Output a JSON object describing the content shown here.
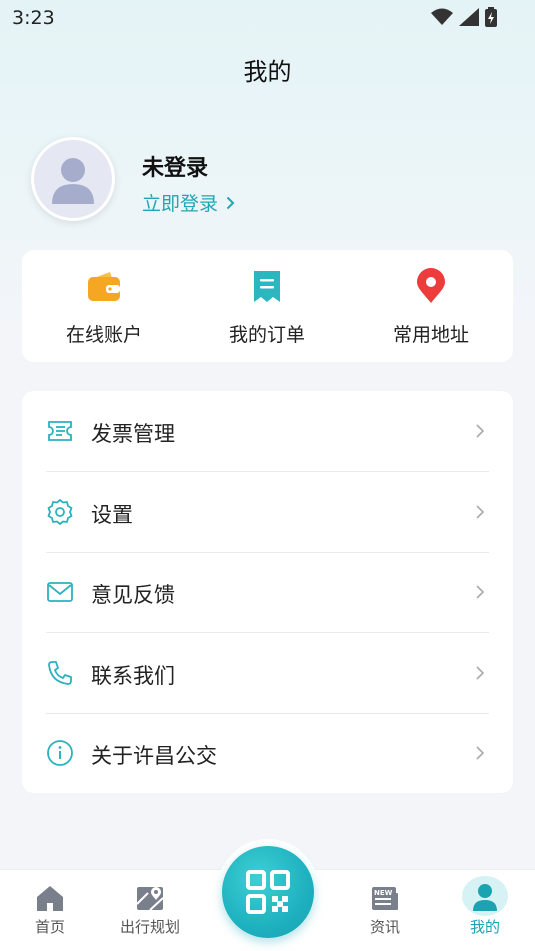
{
  "status_bar": {
    "time": "3:23"
  },
  "header": {
    "title": "我的"
  },
  "profile": {
    "name": "未登录",
    "login_link": "立即登录"
  },
  "quick_actions": [
    {
      "label": "在线账户",
      "icon": "wallet-icon"
    },
    {
      "label": "我的订单",
      "icon": "receipt-icon"
    },
    {
      "label": "常用地址",
      "icon": "location-pin-icon"
    }
  ],
  "menu": [
    {
      "label": "发票管理",
      "icon": "ticket-icon"
    },
    {
      "label": "设置",
      "icon": "gear-icon"
    },
    {
      "label": "意见反馈",
      "icon": "mail-icon"
    },
    {
      "label": "联系我们",
      "icon": "phone-icon"
    },
    {
      "label": "关于许昌公交",
      "icon": "info-icon"
    }
  ],
  "tabbar": {
    "items": [
      {
        "label": "首页",
        "icon": "home-icon"
      },
      {
        "label": "出行规划",
        "icon": "map-icon"
      },
      {
        "label": "资讯",
        "icon": "news-icon"
      },
      {
        "label": "我的",
        "icon": "person-icon",
        "active": true
      }
    ],
    "center_button": {
      "icon": "qr-code-icon"
    }
  },
  "colors": {
    "accent": "#1ba3b2",
    "wallet": "#f5a623",
    "receipt": "#2bb6c0",
    "pin": "#ee3b3b"
  }
}
